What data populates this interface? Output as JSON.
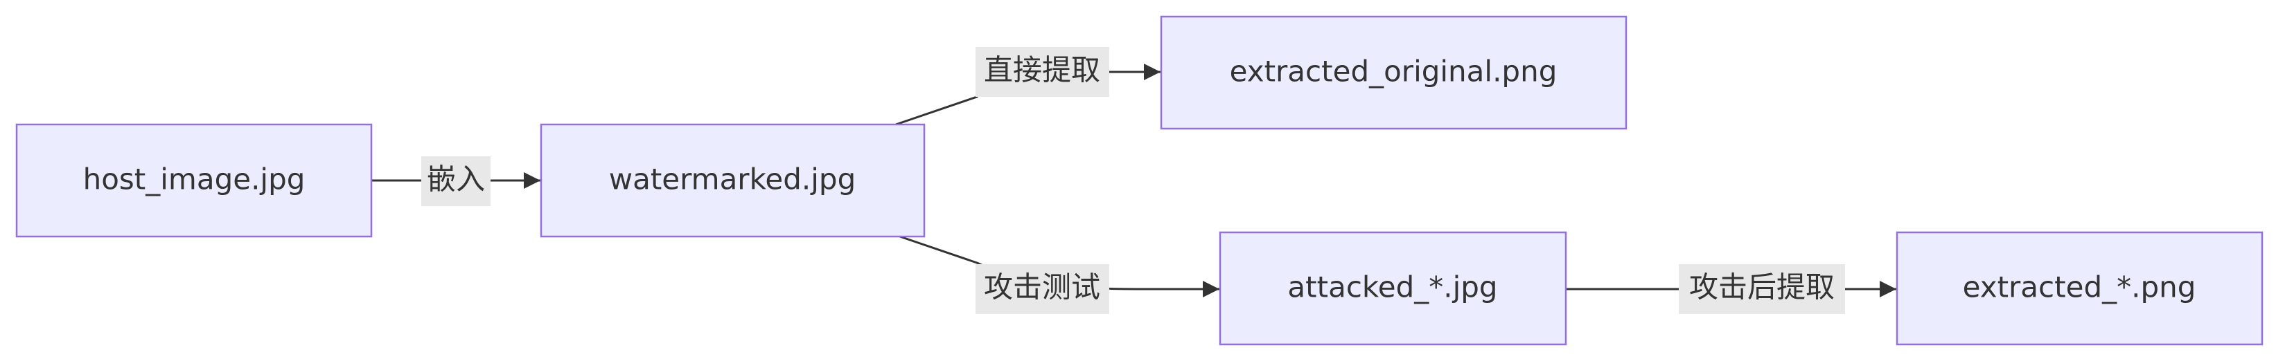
{
  "nodes": {
    "host_image": {
      "label": "host_image.jpg"
    },
    "watermarked": {
      "label": "watermarked.jpg"
    },
    "extracted_original": {
      "label": "extracted_original.png"
    },
    "attacked": {
      "label": "attacked_*.jpg"
    },
    "extracted_attacked": {
      "label": "extracted_*.png"
    }
  },
  "edges": {
    "embed": {
      "from": "host_image",
      "to": "watermarked",
      "label": "嵌入"
    },
    "direct_extract": {
      "from": "watermarked",
      "to": "extracted_original",
      "label": "直接提取"
    },
    "attack_test": {
      "from": "watermarked",
      "to": "attacked",
      "label": "攻击测试"
    },
    "extract_after_attack": {
      "from": "attacked",
      "to": "extracted_attacked",
      "label": "攻击后提取"
    }
  },
  "colors": {
    "node_fill": "#ececff",
    "node_stroke": "#9370db",
    "edge_stroke": "#333333",
    "label_background": "#e8e8e8",
    "text": "#333333"
  }
}
